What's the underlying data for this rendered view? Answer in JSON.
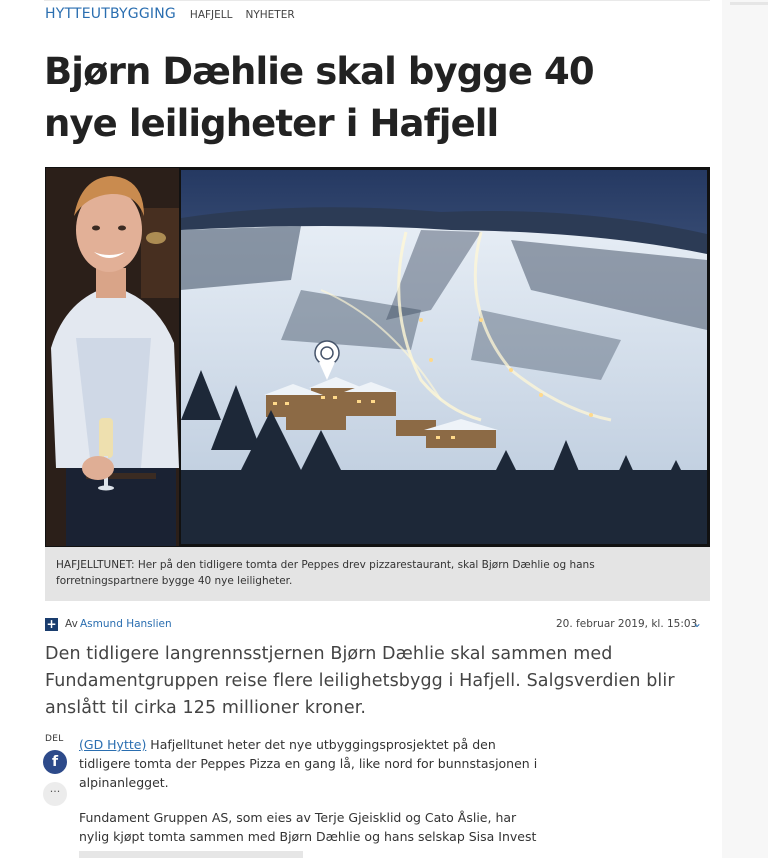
{
  "category": "HYTTEUTBYGGING",
  "tags": [
    "HAFJELL",
    "NYHETER"
  ],
  "headline": {
    "line1": "Bjørn Dæhlie skal bygge 40",
    "line2": "nye leiligheter i Hafjell"
  },
  "image": {
    "left_photo": "person-photo",
    "right_photo": "ski-resort-aerial-photo",
    "caption": "HAFJELLTUNET: Her på den tidligere tomta der Peppes drev pizzarestaurant, skal Bjørn Dæhlie og hans forretningspartnere bygge 40 nye leiligheter."
  },
  "byline": {
    "by_label": "Av",
    "author": "Asmund Hanslien",
    "date": "20. februar 2019, kl. 15:03",
    "expand_icon": "chevron-down-icon",
    "plus_icon": "plus-icon"
  },
  "ingress": "Den tidligere langrennsstjernen Bjørn Dæhlie skal sammen med Fundamentgruppen reise flere leilighetsbygg i Hafjell. Salgsverdien blir anslått til cirka 125 millioner kroner.",
  "share": {
    "label": "DEL",
    "facebook_icon": "facebook-icon",
    "more_icon": "more-icon"
  },
  "body": {
    "p1_source": "(GD Hytte)",
    "p1_text": " Hafjelltunet heter det nye utbyggingsprosjektet på den tidligere tomta der Peppes Pizza en gang lå, like nord for bunnstasjonen i alpinanlegget.",
    "p2_text": "Fundament Gruppen AS, som eies av Terje Gjeisklid og Cato Åslie, har nylig kjøpt tomta sammen med Bjørn Dæhlie og hans selskap Sisa Invest AS."
  },
  "colors": {
    "link": "#2a6eb0",
    "headline": "#222222",
    "caption_bg": "#e4e4e4",
    "facebook": "#2d4a8a",
    "plus_bg": "#1a3d6e"
  }
}
